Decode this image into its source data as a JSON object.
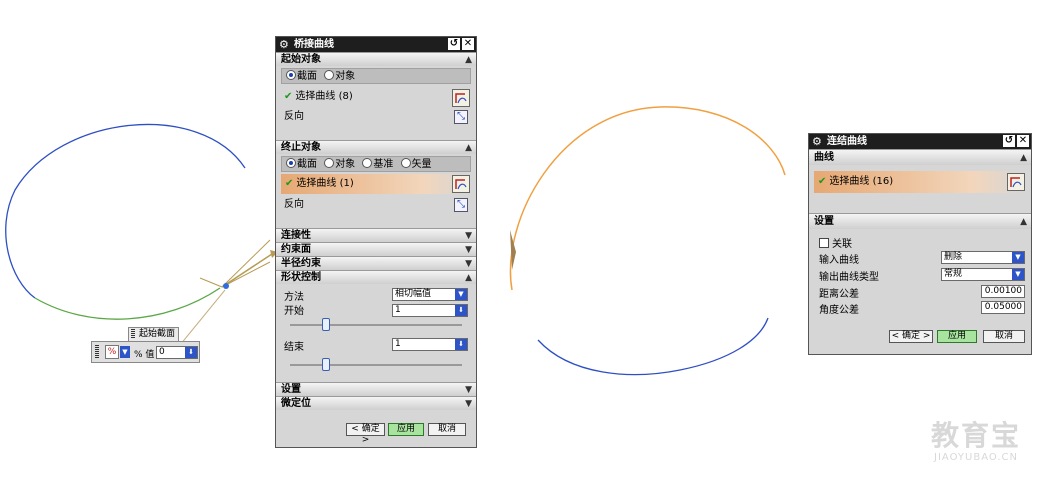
{
  "bridge_dialog": {
    "title": "桥接曲线",
    "start_object": {
      "heading": "起始对象",
      "radios": [
        "截面",
        "对象"
      ],
      "select_label": "选择曲线 (8)",
      "reverse_label": "反向"
    },
    "end_object": {
      "heading": "终止对象",
      "radios": [
        "截面",
        "对象",
        "基准",
        "矢量"
      ],
      "select_label": "选择曲线 (1)",
      "reverse_label": "反向"
    },
    "collapsed_sections": [
      "连接性",
      "约束面",
      "半径约束"
    ],
    "shape_control": {
      "heading": "形状控制",
      "method_label": "方法",
      "method_value": "相切幅值",
      "start_label": "开始",
      "start_value": "1",
      "end_label": "结束",
      "end_value": "1"
    },
    "bottom_sections": [
      "设置",
      "微定位"
    ],
    "buttons": {
      "ok": "< 确定 >",
      "apply": "应用",
      "cancel": "取消"
    }
  },
  "join_dialog": {
    "title": "连结曲线",
    "curve_heading": "曲线",
    "select_label": "选择曲线 (16)",
    "settings_heading": "设置",
    "associative_label": "关联",
    "input_curve_label": "输入曲线",
    "input_curve_value": "删除",
    "output_type_label": "输出曲线类型",
    "output_type_value": "常规",
    "distance_tol_label": "距离公差",
    "distance_tol_value": "0.00100",
    "angle_tol_label": "角度公差",
    "angle_tol_value": "0.05000",
    "buttons": {
      "ok": "< 确定 >",
      "apply": "应用",
      "cancel": "取消"
    }
  },
  "float_toolbar": {
    "tag_label": "起始截面",
    "percent_label": "% 值",
    "value": "0"
  },
  "watermark": {
    "text": "教育宝",
    "url": "JIAOYUBAO.CN"
  },
  "colors": {
    "curve_blue": "#2e4fc4",
    "curve_green": "#5aa845",
    "curve_orange": "#f0a040",
    "highlight": "#e6a873",
    "apply_green": "#a8e4a0"
  }
}
